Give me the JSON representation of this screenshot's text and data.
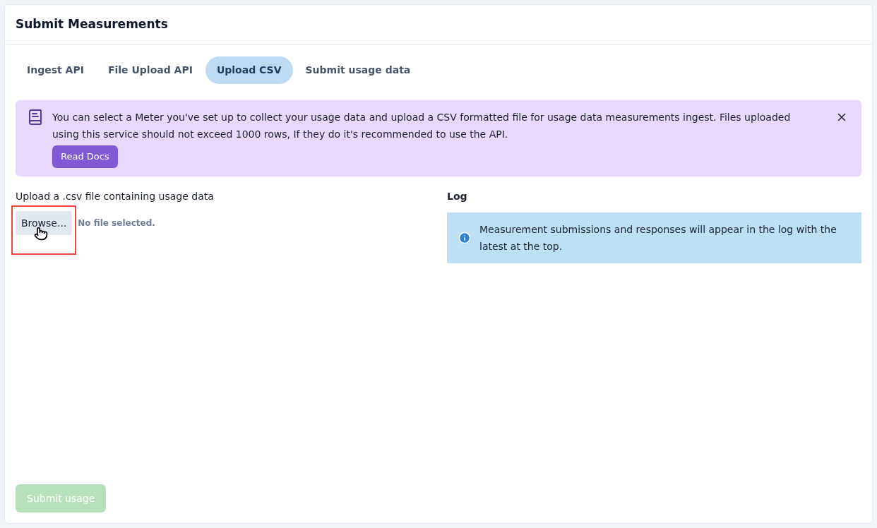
{
  "card": {
    "title": "Submit Measurements"
  },
  "tabs": [
    {
      "label": "Ingest API",
      "selected": false
    },
    {
      "label": "File Upload API",
      "selected": false
    },
    {
      "label": "Upload CSV",
      "selected": true
    },
    {
      "label": "Submit usage data",
      "selected": false
    }
  ],
  "notice": {
    "text": "You can select a Meter you've set up to collect your usage data and upload a CSV formatted file for usage data measurements ingest. Files uploaded using this service should not exceed 1000 rows, If they do it's recommended to use the API.",
    "button": "Read Docs",
    "dismissible": true
  },
  "upload": {
    "label": "Upload a .csv file containing usage data",
    "browse_button": "Browse...",
    "file_status": "No file selected.",
    "highlighted": true,
    "cursor_on_button": true
  },
  "log": {
    "title": "Log",
    "info": "Measurement submissions and responses will appear in the log with the latest at the top."
  },
  "submit_button": {
    "label": "Submit usage",
    "disabled": true
  }
}
